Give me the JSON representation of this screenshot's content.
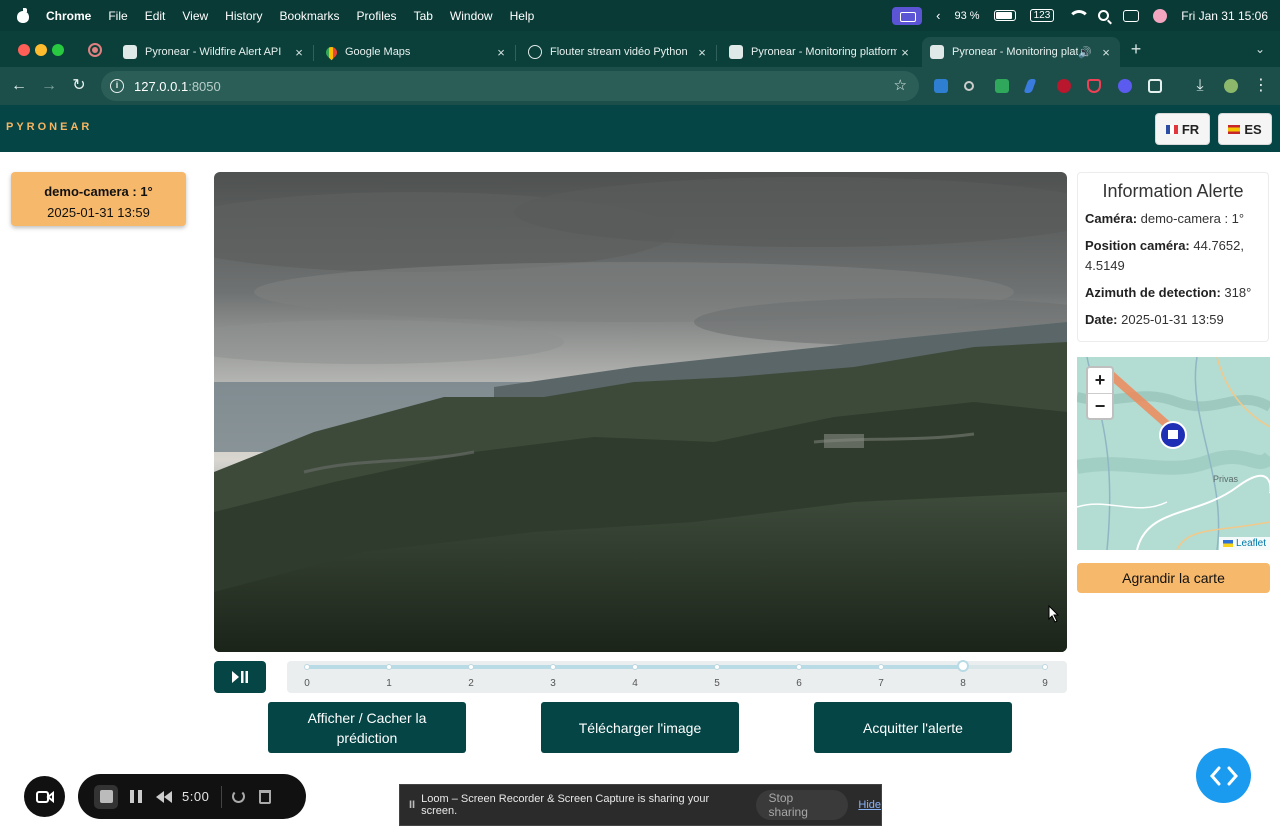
{
  "menubar": {
    "app": "Chrome",
    "items": [
      "File",
      "Edit",
      "View",
      "History",
      "Bookmarks",
      "Profiles",
      "Tab",
      "Window",
      "Help"
    ],
    "battery": "93 %",
    "input": "123",
    "clock": "Fri Jan 31  15:06"
  },
  "tabs": [
    {
      "title": "Pyronear - Wildfire Alert API"
    },
    {
      "title": "Google Maps"
    },
    {
      "title": "Flouter stream vidéo Python"
    },
    {
      "title": "Pyronear - Monitoring platform"
    },
    {
      "title": "Pyronear - Monitoring platform"
    }
  ],
  "toolbar": {
    "url_host": "127.0.0.1",
    "url_port": ":8050"
  },
  "header": {
    "logo": "PYRONEAR",
    "lang_fr": "FR",
    "lang_es": "ES"
  },
  "alert_card": {
    "camera": "demo-camera : 1°",
    "datetime": "2025-01-31 13:59"
  },
  "slider": {
    "marks": [
      "0",
      "1",
      "2",
      "3",
      "4",
      "5",
      "6",
      "7",
      "8",
      "9"
    ],
    "value": 8,
    "max": 9
  },
  "actions": {
    "toggle_prediction": "Afficher / Cacher la prédiction",
    "download": "Télécharger l'image",
    "acknowledge": "Acquitter l'alerte"
  },
  "info": {
    "title": "Information Alerte",
    "camera_label": "Caméra:",
    "camera_value": " demo-camera : 1°",
    "position_label": "Position caméra:",
    "position_value": " 44.7652, 4.5149",
    "azimuth_label": "Azimuth de detection:",
    "azimuth_value": " 318°",
    "date_label": "Date:",
    "date_value": " 2025-01-31 13:59"
  },
  "map": {
    "zoom_in": "+",
    "zoom_out": "−",
    "place": "Privas",
    "attribution": "Leaflet"
  },
  "enlarge_map": "Agrandir la carte",
  "recorder": {
    "time": "5:00"
  },
  "share_bar": {
    "pause_glyph": "II",
    "message": "Loom – Screen Recorder & Screen Capture is sharing your screen.",
    "stop": "Stop sharing",
    "hide": "Hide"
  },
  "colors": {
    "brand_dark": "#054546",
    "brand_orange": "#f6b86b",
    "fab_blue": "#1a9bef"
  }
}
